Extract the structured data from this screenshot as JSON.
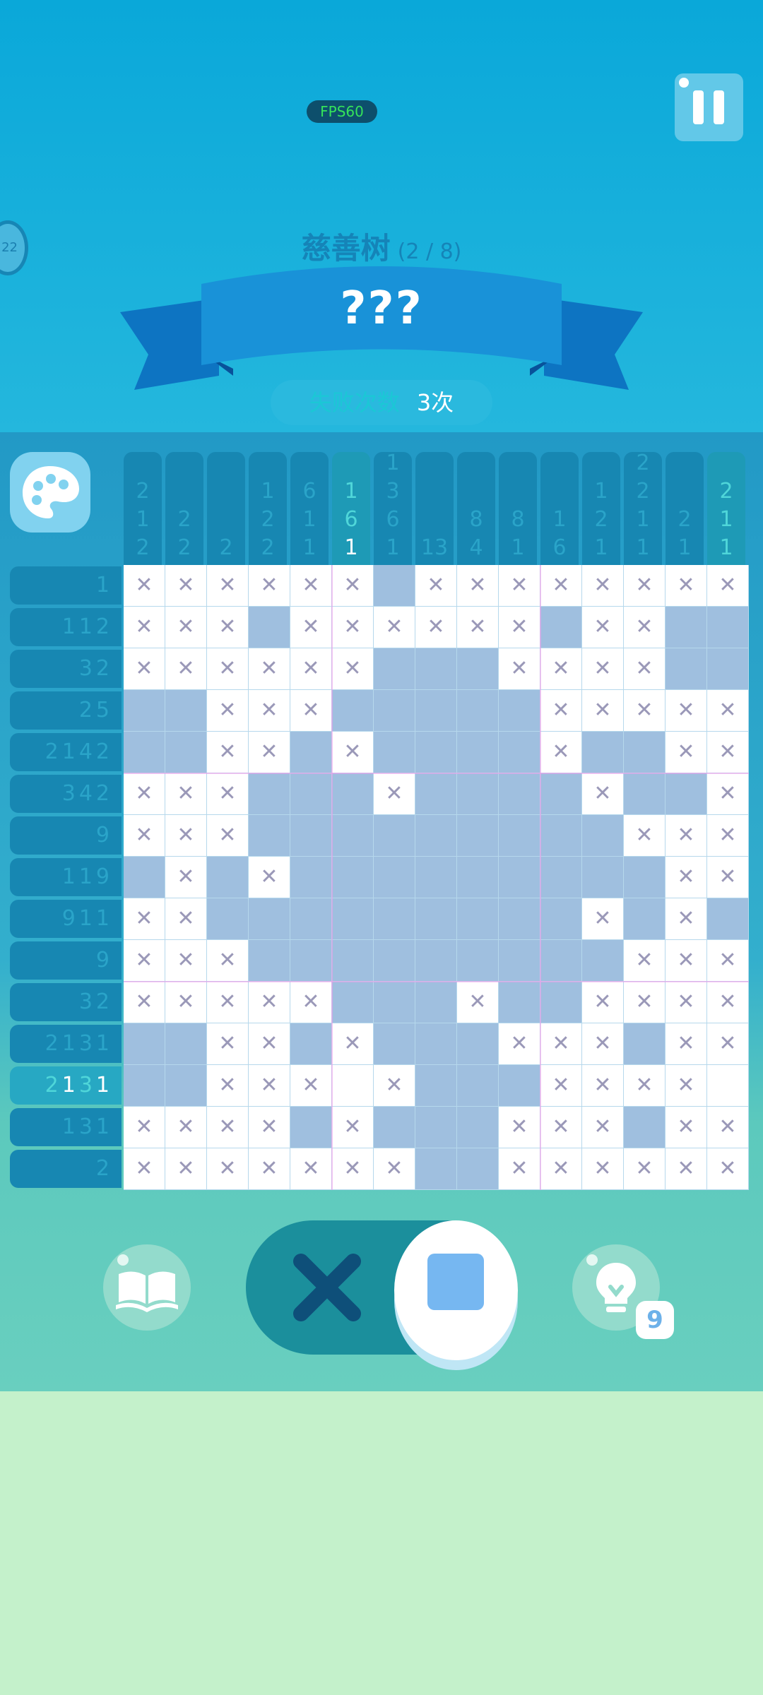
{
  "fps_label": "FPS60",
  "side_badge": "22",
  "level": {
    "title": "慈善树",
    "progress": "(2 / 8)"
  },
  "puzzle_name": "???",
  "fails": {
    "label": "失败次数",
    "value": "3次"
  },
  "hint_count": "9",
  "column_clues": [
    {
      "nums": [
        "2",
        "1",
        "2"
      ],
      "highlight": false,
      "done": 0
    },
    {
      "nums": [
        "2",
        "2"
      ],
      "highlight": false,
      "done": 0
    },
    {
      "nums": [
        "2"
      ],
      "highlight": false,
      "done": 0
    },
    {
      "nums": [
        "1",
        "2",
        "2"
      ],
      "highlight": false,
      "done": 0
    },
    {
      "nums": [
        "6",
        "1",
        "1"
      ],
      "highlight": false,
      "done": 0
    },
    {
      "nums": [
        "1",
        "6",
        "1"
      ],
      "highlight": true,
      "done": 1
    },
    {
      "nums": [
        "1",
        "3",
        "6",
        "1"
      ],
      "highlight": false,
      "done": 0
    },
    {
      "nums": [
        "13"
      ],
      "highlight": false,
      "done": 0
    },
    {
      "nums": [
        "8",
        "4"
      ],
      "highlight": false,
      "done": 0
    },
    {
      "nums": [
        "8",
        "1"
      ],
      "highlight": false,
      "done": 0
    },
    {
      "nums": [
        "1",
        "6"
      ],
      "highlight": false,
      "done": 0
    },
    {
      "nums": [
        "1",
        "2",
        "1"
      ],
      "highlight": false,
      "done": 0
    },
    {
      "nums": [
        "2",
        "2",
        "1",
        "1"
      ],
      "highlight": false,
      "done": 0
    },
    {
      "nums": [
        "2",
        "1"
      ],
      "highlight": false,
      "done": 0
    },
    {
      "nums": [
        "2",
        "1",
        "1"
      ],
      "highlight": true,
      "done": 0
    }
  ],
  "row_clues": [
    {
      "nums": [
        "1"
      ],
      "highlight": false
    },
    {
      "nums": [
        "1",
        "1",
        "2"
      ],
      "highlight": false
    },
    {
      "nums": [
        "3",
        "2"
      ],
      "highlight": false
    },
    {
      "nums": [
        "2",
        "5"
      ],
      "highlight": false
    },
    {
      "nums": [
        "2",
        "1",
        "4",
        "2"
      ],
      "highlight": false
    },
    {
      "nums": [
        "3",
        "4",
        "2"
      ],
      "highlight": false
    },
    {
      "nums": [
        "9"
      ],
      "highlight": false
    },
    {
      "nums": [
        "1",
        "1",
        "9"
      ],
      "highlight": false
    },
    {
      "nums": [
        "9",
        "1",
        "1"
      ],
      "highlight": false
    },
    {
      "nums": [
        "9"
      ],
      "highlight": false
    },
    {
      "nums": [
        "3",
        "2"
      ],
      "highlight": false
    },
    {
      "nums": [
        "2",
        "1",
        "3",
        "1"
      ],
      "highlight": false
    },
    {
      "nums": [
        "2",
        "1",
        "3",
        "1"
      ],
      "highlight": true
    },
    {
      "nums": [
        "1",
        "3",
        "1"
      ],
      "highlight": false
    },
    {
      "nums": [
        "2"
      ],
      "highlight": false
    }
  ],
  "grid_legend": {
    "F": "filled",
    "X": "crossed",
    ".": "empty"
  },
  "grid": [
    "XXXXXXFXXXXXXXX",
    "XXXFXXXXXXFXXFF",
    "XXXXXXFFFXXXXFF",
    "FFXXXFFFFFXXXXX",
    "FFXXFXFFFFXFFXX",
    "XXXFFFXFFFFXFFX",
    "XXXFFFFFFFFFXXX",
    "FXFXFFFFFFFFFXX",
    "XXFFFFFFFFFXFXF",
    "XXXFFFFFFFFFXXX",
    "XXXXXFFFXFFXXXX",
    "FFXXFXFFFXXXFXX",
    "FFXXX.XFFFXXXX.",
    "XXXXFXFFFXXXFXX",
    "XXXXXXXFFXXXXXX"
  ]
}
